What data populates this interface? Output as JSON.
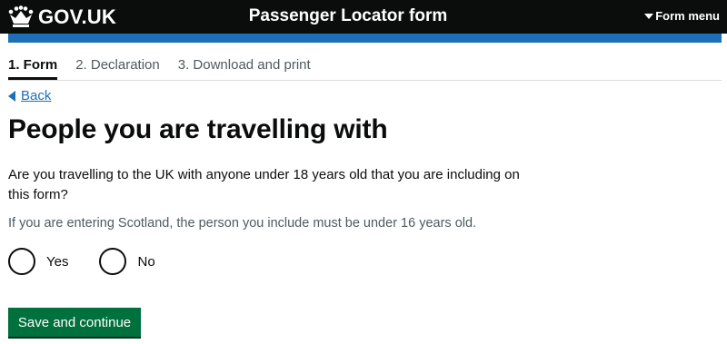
{
  "header": {
    "logo_text": "GOV.UK",
    "logo_icon": "crown-icon",
    "service_name": "Passenger Locator form",
    "menu_label": "Form menu",
    "background_color": "#0b0c0c",
    "bar_color": "#1d70b8"
  },
  "steps": [
    {
      "label": "1. Form",
      "active": true
    },
    {
      "label": "2. Declaration",
      "active": false
    },
    {
      "label": "3. Download and print",
      "active": false
    }
  ],
  "back_link": "Back",
  "page_title": "People you are travelling with",
  "question": "Are you travelling to the UK with anyone under 18 years old that you are including on this form?",
  "hint": "If you are entering Scotland, the person you include must be under 16 years old.",
  "options": [
    {
      "label": "Yes",
      "selected": false
    },
    {
      "label": "No",
      "selected": false
    }
  ],
  "submit_label": "Save and continue",
  "submit_color": "#00703c"
}
